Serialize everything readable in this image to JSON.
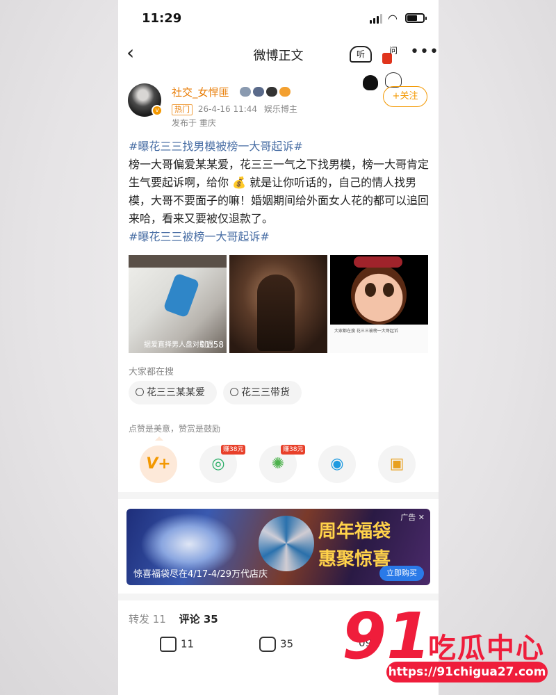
{
  "status_bar": {
    "time": "11:29"
  },
  "nav": {
    "title": "微博正文",
    "listen_label": "听",
    "ask_label": "问"
  },
  "author": {
    "name": "社交_女悍匪",
    "hot_badge": "热门",
    "time": "26-4-16 11:44",
    "role": "娱乐博主",
    "location": "发布于 重庆",
    "follow_label": "+关注"
  },
  "post": {
    "tag1": "#曝花三三找男模被榜一大哥起诉#",
    "body_part1": "榜一大哥偏爱某某爱，花三三一气之下找男模，榜一大哥肯定生气要起诉啊，给你",
    "emoji": "💰",
    "body_part2": "就是让你听话的，自己的情人找男模，大哥不要面子的嘛！婚姻期间给外面女人花的都可以追回来哈，看来又要被仅退款了。",
    "tag2": "#曝花三三被榜一大哥起诉#"
  },
  "media": {
    "video_caption": "据爱直择男人盘对别遇",
    "video_duration": "01:58",
    "img3_panel_text": "大家都在搜 花三三被榜一大哥起诉"
  },
  "search": {
    "label": "大家都在搜",
    "chips": [
      "花三三某某爱",
      "花三三带货"
    ]
  },
  "reward": {
    "label": "点赞是美意，赞赏是鼓励",
    "earn_badges": [
      "赚38元",
      "赚38元"
    ],
    "icons": [
      "reward-v-icon",
      "wechat-icon",
      "moments-icon",
      "qq-icon",
      "save-image-icon"
    ]
  },
  "ad": {
    "label": "广告 ✕",
    "headline1": "周年福袋",
    "headline2": "惠聚惊喜",
    "caption": "惊喜福袋尽在4/17-4/29万代店庆",
    "buy_label": "立即购买"
  },
  "tabs": {
    "repost": "转发 11",
    "comment": "评论 35"
  },
  "actions": {
    "repost_count": "11",
    "comment_count": "35",
    "like_count": "09"
  },
  "watermark": {
    "number": "91",
    "text": "吃瓜中心",
    "url": "https://91chigua27.com"
  },
  "colors": {
    "accent": "#f39800",
    "link": "#4a6fa5",
    "watermark_red": "#ef1d3b"
  }
}
